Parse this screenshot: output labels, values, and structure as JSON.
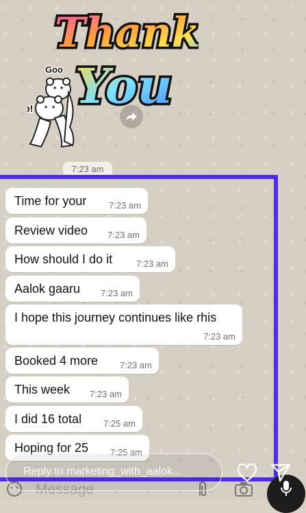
{
  "sticker": {
    "line1": "Thank",
    "line2": "You",
    "goo_label": "Goo",
    "yup_label": "Yup!"
  },
  "top_timestamp": "7:23 am",
  "messages": [
    {
      "text": "Time for your",
      "time": "7:23 am"
    },
    {
      "text": "Review video",
      "time": "7:23 am"
    },
    {
      "text": "How should I do it",
      "time": "7:23 am"
    },
    {
      "text": "Aalok gaaru",
      "time": "7:23 am"
    },
    {
      "text": "I hope this journey continues like rhis",
      "time": "7:23 am"
    },
    {
      "text": "Booked 4 more",
      "time": "7:23 am"
    },
    {
      "text": "This week",
      "time": "7:23 am"
    },
    {
      "text": "I did 16 total",
      "time": "7:25 am"
    },
    {
      "text": "Hoping for 25",
      "time": "7:25 am"
    }
  ],
  "reply": {
    "placeholder": "Reply to marketing_with_aalok..."
  },
  "composer": {
    "placeholder": "Message"
  },
  "colors": {
    "highlight_border": "#4b2cf0",
    "bubble": "#ffffff",
    "chat_background": "#d6cfc4"
  }
}
